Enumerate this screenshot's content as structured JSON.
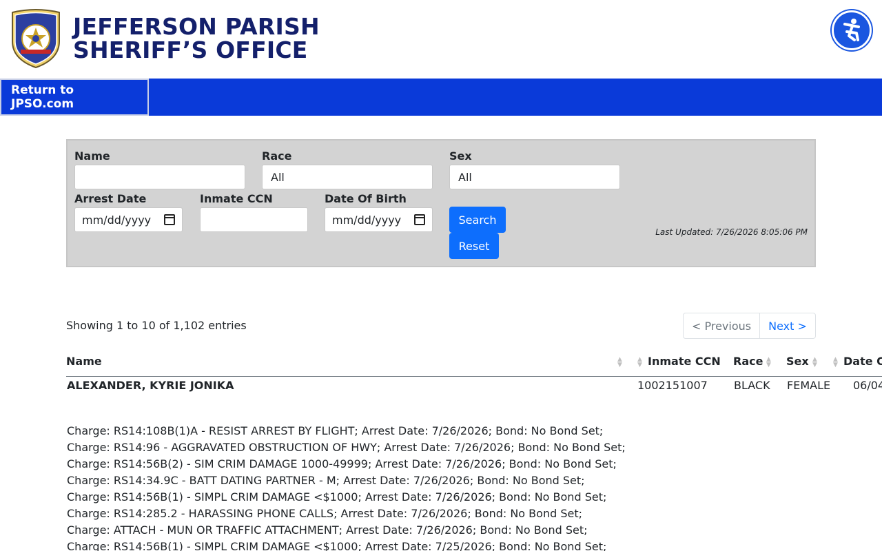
{
  "header": {
    "brand_line1": "JEFFERSON PARISH",
    "brand_line2": "SHERIFF’S OFFICE",
    "logo_icon": "sheriff-badge-icon",
    "accessibility_icon": "accessibility-icon"
  },
  "nav": {
    "return_label": "Return to JPSO.com"
  },
  "filters": {
    "name_label": "Name",
    "name_value": "",
    "race_label": "Race",
    "race_value": "All",
    "sex_label": "Sex",
    "sex_value": "All",
    "arrest_date_label": "Arrest Date",
    "arrest_date_placeholder": "mm/dd/yyyy",
    "ccn_label": "Inmate CCN",
    "ccn_value": "",
    "dob_label": "Date Of Birth",
    "dob_placeholder": "mm/dd/yyyy",
    "search_label": "Search",
    "reset_label": "Reset",
    "last_updated": "Last Updated: 7/26/2026 8:05:06 PM"
  },
  "table": {
    "showing": "Showing 1 to 10 of 1,102 entries",
    "prev_label": "< Previous",
    "next_label": "Next >",
    "columns": [
      "Name",
      "Inmate CCN",
      "Race",
      "Sex",
      "Date O"
    ],
    "rows": [
      {
        "name": "ALEXANDER, KYRIE JONIKA",
        "ccn": "1002151007",
        "race": "BLACK",
        "sex": "FEMALE",
        "date": "06/04",
        "charges": [
          "Charge: RS14:108B(1)A - RESIST ARREST BY FLIGHT; Arrest Date: 7/26/2026; Bond: No Bond Set;",
          "Charge: RS14:96 - AGGRAVATED OBSTRUCTION OF HWY; Arrest Date: 7/26/2026; Bond: No Bond Set;",
          "Charge: RS14:56B(2) - SIM CRIM DAMAGE 1000-49999; Arrest Date: 7/26/2026; Bond: No Bond Set;",
          "Charge: RS14:34.9C - BATT DATING PARTNER - M; Arrest Date: 7/26/2026; Bond: No Bond Set;",
          "Charge: RS14:56B(1) - SIMPL CRIM DAMAGE <$1000; Arrest Date: 7/26/2026; Bond: No Bond Set;",
          "Charge: RS14:285.2 - HARASSING PHONE CALLS; Arrest Date: 7/26/2026; Bond: No Bond Set;",
          "Charge: ATTACH - MUN OR TRAFFIC ATTACHMENT; Arrest Date: 7/26/2026; Bond: No Bond Set;",
          "Charge: RS14:56B(1) - SIMPL CRIM DAMAGE <$1000; Arrest Date: 7/25/2026; Bond: No Bond Set;"
        ]
      }
    ]
  },
  "colors": {
    "navy": "#14206b",
    "nav_blue": "#0a3ad9",
    "button_blue": "#0d6efd",
    "panel_gray": "#d3d3d3"
  }
}
